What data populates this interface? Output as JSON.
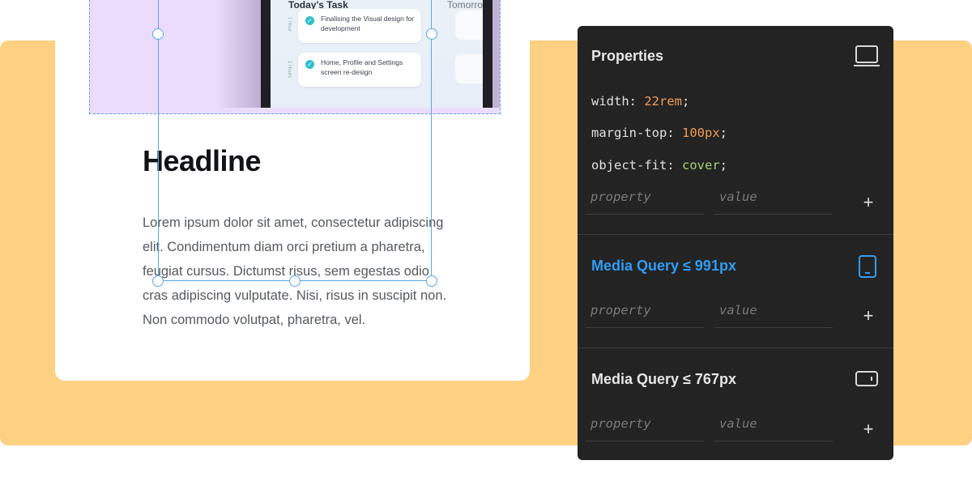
{
  "canvas": {
    "preview_app": {
      "today_title": "Today's Task",
      "tomorrow_title": "Tomorrow",
      "tasks": [
        {
          "label": "Finalising the Visual design for development",
          "hours": "1 Hour"
        },
        {
          "label": "Home, Profile and Settings screen re-design",
          "hours": "2 Hours"
        }
      ]
    },
    "headline": "Headline",
    "body": "Lorem ipsum dolor sit amet, consectetur adipiscing elit. Condimentum diam orci pretium a pharetra, feugiat cursus. Dictumst risus, sem egestas odio cras adipiscing vulputate. Nisi, risus in suscipit non. Non commodo volutpat, pharetra, vel."
  },
  "panel": {
    "title": "Properties",
    "title_icon": "desktop-icon",
    "declarations": [
      {
        "property": "width",
        "value": "22rem",
        "value_color": "#f39b55"
      },
      {
        "property": "margin-top",
        "value": "100px",
        "value_color": "#f39b55"
      },
      {
        "property": "object-fit",
        "value": "cover",
        "value_color": "#a7d27a"
      }
    ],
    "property_placeholder": "property",
    "value_placeholder": "value",
    "add_label": "+",
    "media_queries": [
      {
        "title": "Media Query ≤ 991px",
        "icon": "tablet-icon",
        "active": true
      },
      {
        "title": "Media Query ≤ 767px",
        "icon": "mobile-landscape-icon",
        "active": false
      }
    ]
  },
  "colors": {
    "accent": "#2f9cf4",
    "selection": "#5aa6ec",
    "background_band": "#fcd182",
    "panel_bg": "#232323",
    "image_bg": "#ebdcfc"
  }
}
